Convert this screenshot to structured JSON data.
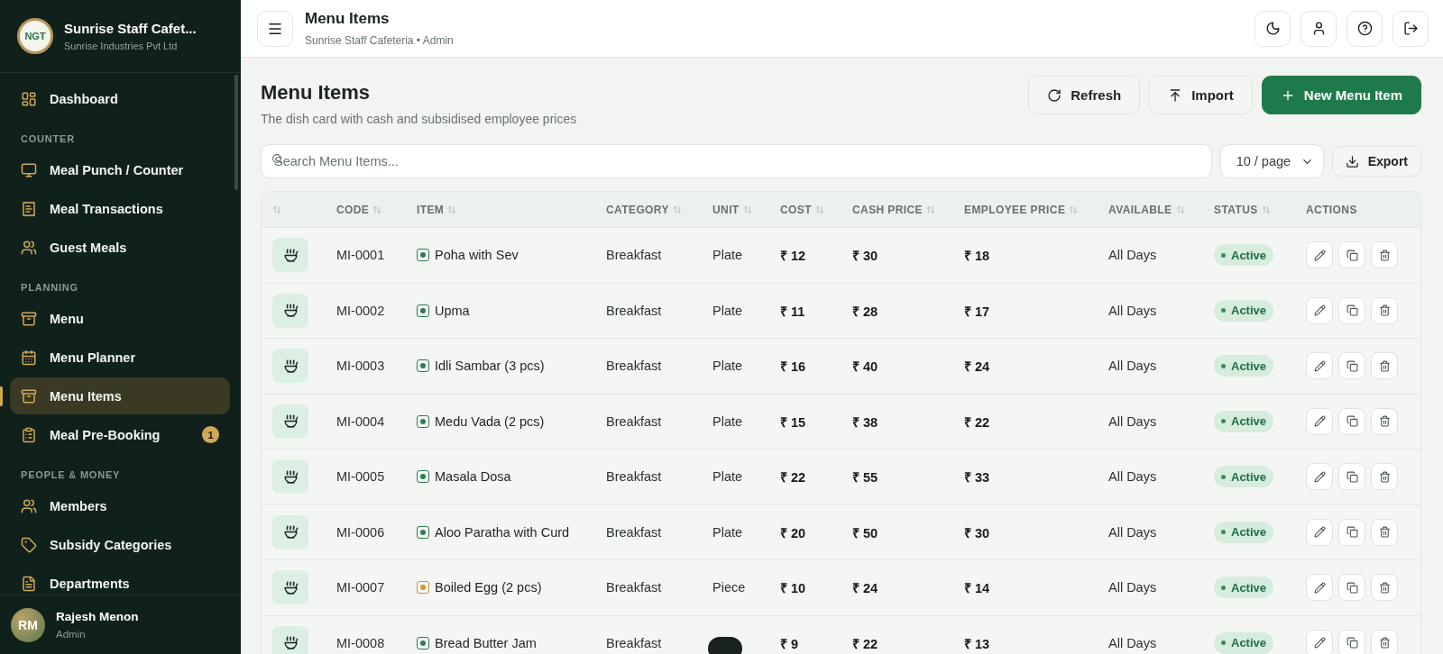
{
  "sidebar": {
    "brand": {
      "logo_text": "NGT",
      "title": "Sunrise Staff Cafet...",
      "subtitle": "Sunrise Industries Pvt Ltd"
    },
    "sections": [
      {
        "items": [
          {
            "label": "Dashboard",
            "selected": false
          }
        ]
      },
      {
        "heading": "COUNTER",
        "items": [
          {
            "label": "Meal Punch / Counter",
            "selected": false
          },
          {
            "label": "Meal Transactions",
            "selected": false
          },
          {
            "label": "Guest Meals",
            "selected": false
          }
        ]
      },
      {
        "heading": "PLANNING",
        "items": [
          {
            "label": "Menu",
            "selected": false
          },
          {
            "label": "Menu Planner",
            "selected": false
          },
          {
            "label": "Menu Items",
            "selected": true
          },
          {
            "label": "Meal Pre-Booking",
            "selected": false,
            "badge": "1"
          }
        ]
      },
      {
        "heading": "PEOPLE & MONEY",
        "items": [
          {
            "label": "Members",
            "selected": false
          },
          {
            "label": "Subsidy Categories",
            "selected": false
          },
          {
            "label": "Departments",
            "selected": false
          }
        ]
      }
    ],
    "user": {
      "initials": "RM",
      "name": "Rajesh Menon",
      "role": "Admin"
    }
  },
  "header": {
    "title": "Menu Items",
    "subtitle": "Sunrise Staff Cafeteria • Admin"
  },
  "page": {
    "title": "Menu Items",
    "description": "The dish card with cash and subsidised employee prices",
    "actions": [
      {
        "label": "Refresh",
        "kind": "refresh"
      },
      {
        "label": "Import",
        "kind": "import"
      },
      {
        "label": "New Menu Item",
        "kind": "primary"
      }
    ],
    "search": {
      "placeholder": "Search Menu Items..."
    },
    "page_size": "10 / page",
    "export": "Export"
  },
  "table": {
    "columns": [
      {
        "label": "CODE",
        "sortable": true
      },
      {
        "label": "ITEM",
        "sortable": true
      },
      {
        "label": "CATEGORY",
        "sortable": true
      },
      {
        "label": "UNIT",
        "sortable": true
      },
      {
        "label": "COST",
        "sortable": true
      },
      {
        "label": "CASH PRICE",
        "sortable": true
      },
      {
        "label": "EMPLOYEE PRICE",
        "sortable": true
      },
      {
        "label": "AVAILABLE",
        "sortable": true
      },
      {
        "label": "STATUS",
        "sortable": true
      },
      {
        "label": "ACTIONS",
        "sortable": false
      }
    ],
    "rows": [
      {
        "code": "MI-0001",
        "item": "Poha with Sev",
        "color": "#2e7d4f",
        "category": "Breakfast",
        "unit": "Plate",
        "cost": "₹ 12",
        "cash_price": "₹ 30",
        "employee_price": "₹ 18",
        "available": "All Days",
        "status": "Active"
      },
      {
        "code": "MI-0002",
        "item": "Upma",
        "color": "#2e7d4f",
        "category": "Breakfast",
        "unit": "Plate",
        "cost": "₹ 11",
        "cash_price": "₹ 28",
        "employee_price": "₹ 17",
        "available": "All Days",
        "status": "Active"
      },
      {
        "code": "MI-0003",
        "item": "Idli Sambar (3 pcs)",
        "color": "#2e7d4f",
        "category": "Breakfast",
        "unit": "Plate",
        "cost": "₹ 16",
        "cash_price": "₹ 40",
        "employee_price": "₹ 24",
        "available": "All Days",
        "status": "Active"
      },
      {
        "code": "MI-0004",
        "item": "Medu Vada (2 pcs)",
        "color": "#2e7d4f",
        "category": "Breakfast",
        "unit": "Plate",
        "cost": "₹ 15",
        "cash_price": "₹ 38",
        "employee_price": "₹ 22",
        "available": "All Days",
        "status": "Active"
      },
      {
        "code": "MI-0005",
        "item": "Masala Dosa",
        "color": "#2e7d4f",
        "category": "Breakfast",
        "unit": "Plate",
        "cost": "₹ 22",
        "cash_price": "₹ 55",
        "employee_price": "₹ 33",
        "available": "All Days",
        "status": "Active"
      },
      {
        "code": "MI-0006",
        "item": "Aloo Paratha with Curd",
        "color": "#2e7d4f",
        "category": "Breakfast",
        "unit": "Plate",
        "cost": "₹ 20",
        "cash_price": "₹ 50",
        "employee_price": "₹ 30",
        "available": "All Days",
        "status": "Active"
      },
      {
        "code": "MI-0007",
        "item": "Boiled Egg (2 pcs)",
        "color": "#c9962e",
        "category": "Breakfast",
        "unit": "Piece",
        "cost": "₹ 10",
        "cash_price": "₹ 24",
        "employee_price": "₹ 14",
        "available": "All Days",
        "status": "Active"
      },
      {
        "code": "MI-0008",
        "item": "Bread Butter Jam",
        "color": "#2e7d4f",
        "category": "Breakfast",
        "cost": "₹ 9",
        "cash_price": "₹ 22",
        "employee_price": "₹ 13",
        "available": "All Days",
        "status": "Active"
      }
    ]
  }
}
